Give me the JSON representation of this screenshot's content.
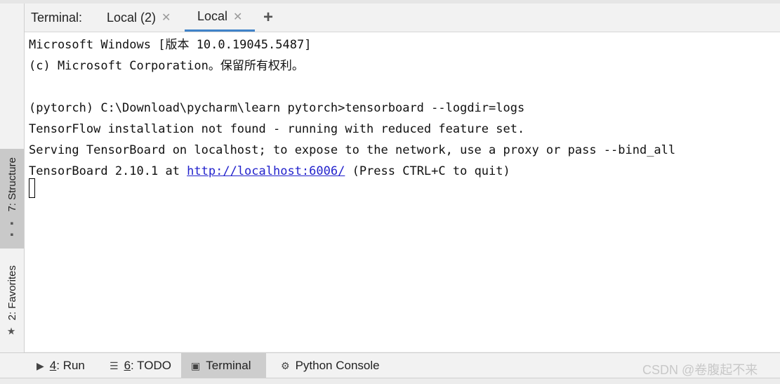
{
  "terminal": {
    "label": "Terminal:",
    "tabs": [
      {
        "label": "Local (2)"
      },
      {
        "label": "Local"
      }
    ],
    "new_tab": "+"
  },
  "left_tools": [
    {
      "label": "7: Structure"
    },
    {
      "label": "2: Favorites"
    }
  ],
  "output": {
    "lines": [
      "Microsoft Windows [版本 10.0.19045.5487]",
      "(c) Microsoft Corporation。保留所有权利。",
      "",
      "(pytorch) C:\\Download\\pycharm\\learn pytorch>tensorboard --logdir=logs",
      "TensorFlow installation not found - running with reduced feature set.",
      "Serving TensorBoard on localhost; to expose to the network, use a proxy or pass --bind_all"
    ],
    "last_line_prefix": "TensorBoard 2.10.1 at ",
    "last_line_link": "http://localhost:6006/",
    "last_line_suffix": " (Press CTRL+C to quit)"
  },
  "bottom_tools": [
    {
      "num": "4",
      "rest": ": Run"
    },
    {
      "num": "6",
      "rest": ": TODO"
    },
    {
      "label": "Terminal"
    },
    {
      "label": "Python Console"
    }
  ],
  "watermark": "CSDN @卷腹起不来",
  "colors": {
    "accent": "#4083c9",
    "link": "#2222cc"
  }
}
